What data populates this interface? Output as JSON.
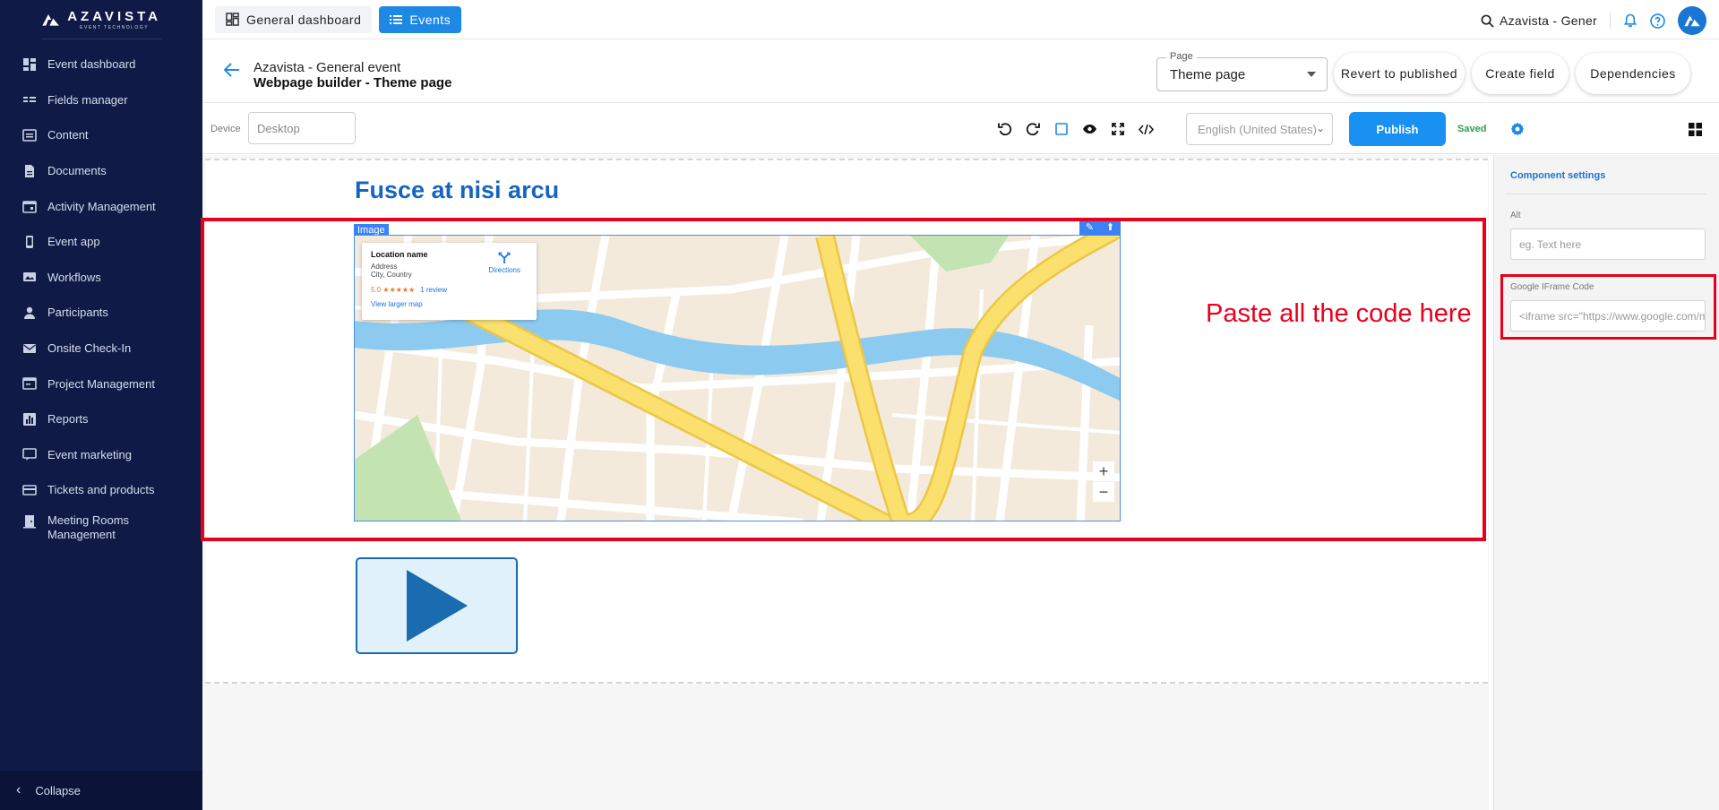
{
  "brand": {
    "name": "AZAVISTA",
    "tagline": "EVENT TECHNOLOGY"
  },
  "sidebar": {
    "items": [
      {
        "label": "Event dashboard",
        "icon": "dashboard-icon"
      },
      {
        "label": "Fields manager",
        "icon": "fields-icon"
      },
      {
        "label": "Content",
        "icon": "content-icon"
      },
      {
        "label": "Documents",
        "icon": "document-icon"
      },
      {
        "label": "Activity Management",
        "icon": "calendar-icon"
      },
      {
        "label": "Event app",
        "icon": "phone-icon"
      },
      {
        "label": "Workflows",
        "icon": "workflow-icon"
      },
      {
        "label": "Participants",
        "icon": "person-icon"
      },
      {
        "label": "Onsite Check-In",
        "icon": "mail-icon"
      },
      {
        "label": "Project Management",
        "icon": "project-icon"
      },
      {
        "label": "Reports",
        "icon": "reports-icon"
      },
      {
        "label": "Event marketing",
        "icon": "marketing-icon"
      },
      {
        "label": "Tickets and products",
        "icon": "ticket-icon"
      },
      {
        "label": "Meeting Rooms Management",
        "icon": "meeting-room-icon"
      }
    ],
    "collapse_label": "Collapse"
  },
  "topbar": {
    "general_label": "General dashboard",
    "events_label": "Events",
    "event_search": "Azavista - Gener"
  },
  "header": {
    "event_name": "Azavista - General event",
    "page_title": "Webpage builder - Theme page",
    "page_select_label": "Page",
    "page_select_value": "Theme page",
    "revert_label": "Revert to published",
    "create_field_label": "Create field",
    "dependencies_label": "Dependencies"
  },
  "toolbar": {
    "device_label": "Device",
    "device_value": "Desktop",
    "language_value": "English (United States)",
    "publish_label": "Publish",
    "status": "Saved"
  },
  "canvas": {
    "headline": "Fusce at nisi arcu",
    "image_tag": "Image",
    "map_card": {
      "location_name": "Location name",
      "address": "Address",
      "city_country": "City, Country",
      "rating": "5.0 ★★★★★",
      "reviews": "1 review",
      "larger_map": "View larger map",
      "directions": "Directions"
    },
    "annotation": "Paste all the code here"
  },
  "panel": {
    "title": "Component settings",
    "alt_label": "Alt",
    "alt_placeholder": "eg. Text here",
    "iframe_label": "Google IFrame Code",
    "iframe_value": "<iframe src=\"https://www.google.com/maps"
  },
  "colors": {
    "sidebar_bg": "#0f1b46",
    "accent": "#1e88e5",
    "annotation_red": "#e8001c",
    "headline_blue": "#1565c0"
  }
}
